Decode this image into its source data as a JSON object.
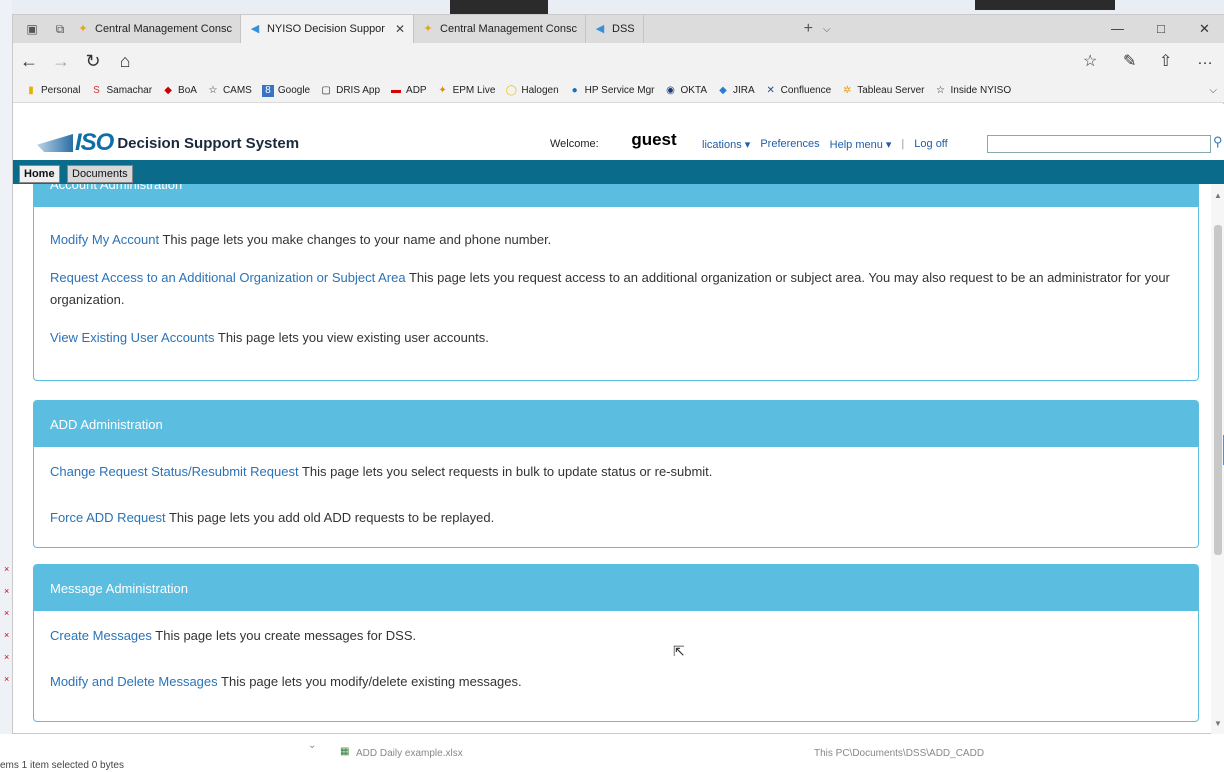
{
  "browser": {
    "tabs": [
      {
        "label": "Central Management Consc",
        "active": false
      },
      {
        "label": "NYISO Decision Suppor",
        "active": true
      },
      {
        "label": "Central Management Consc",
        "active": false
      },
      {
        "label": "DSS",
        "active": false
      }
    ],
    "favorites": [
      "Personal",
      "Samachar",
      "BoA",
      "CAMS",
      "Google",
      "DRIS App",
      "ADP",
      "EPM Live",
      "Halogen",
      "HP Service Mgr",
      "OKTA",
      "JIRA",
      "Confluence",
      "Tableau Server",
      "Inside NYISO"
    ]
  },
  "header": {
    "logo_text": "ISO",
    "app_title": "Decision Support System",
    "welcome_label": "Welcome:",
    "user": "guest",
    "menu": [
      "lications ▾",
      "Preferences",
      "Help menu ▾",
      "|",
      "Log off"
    ]
  },
  "nav_tabs": [
    "Home",
    "Documents"
  ],
  "panels": [
    {
      "title": "Account Administration",
      "items": [
        {
          "link": "Modify My Account",
          "desc": " This page lets you make changes to your name and phone number."
        },
        {
          "link": "Request Access to an Additional Organization or Subject Area",
          "desc": " This page lets you request access to an additional organization or subject area. You may also request to be an administrator for your organization."
        },
        {
          "link": "View Existing User Accounts",
          "desc": " This page lets you view existing user accounts."
        }
      ]
    },
    {
      "title": "ADD Administration",
      "items": [
        {
          "link": "Change Request Status/Resubmit Request",
          "desc": " This page lets you select requests in bulk to update status or re-submit."
        },
        {
          "link": "Force ADD Request",
          "desc": " This page lets you add old ADD requests to be replayed."
        }
      ]
    },
    {
      "title": "Message Administration",
      "items": [
        {
          "link": "Create Messages",
          "desc": " This page lets you create messages for DSS."
        },
        {
          "link": "Modify and Delete Messages",
          "desc": " This page lets you modify/delete existing messages."
        }
      ]
    }
  ],
  "explorer": {
    "file_name": "ADD Daily example.xlsx",
    "file_path": "This PC\\Documents\\DSS\\ADD_CADD",
    "status": "ems   1 item selected  0 bytes"
  }
}
